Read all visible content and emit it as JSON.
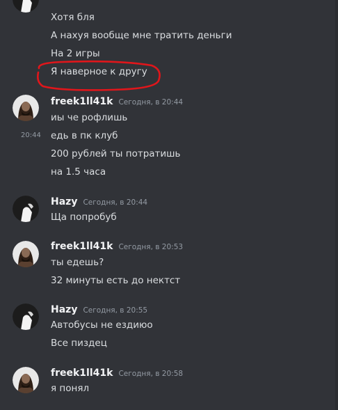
{
  "colors": {
    "background": "#313338",
    "author": "#f2f3f5",
    "text": "#dbdee1",
    "timestamp": "#949ba4",
    "annotation": "#e0161b"
  },
  "prev_group": {
    "lines": [
      "Хотя бля",
      "А нахуя вообще мне тратить деньги",
      "На 2 игры",
      "Я наверное к другу"
    ]
  },
  "groups": [
    {
      "author": "freek1ll41k",
      "timestamp": "Сегодня, в 20:44",
      "avatar_icon": "skull-portrait-avatar",
      "lines": [
        "иы че рофлишь",
        "едь в пк клуб",
        "200 рублей ты потратишь",
        "на 1.5 часа"
      ],
      "hover_time": "20:44"
    },
    {
      "author": "Hazy",
      "timestamp": "Сегодня, в 20:44",
      "avatar_icon": "white-figure-avatar",
      "lines": [
        "Ща попробуб"
      ]
    },
    {
      "author": "freek1ll41k",
      "timestamp": "Сегодня, в 20:53",
      "avatar_icon": "skull-portrait-avatar",
      "lines": [
        "ты едешь?",
        "32 минуты есть до нектст"
      ]
    },
    {
      "author": "Hazy",
      "timestamp": "Сегодня, в 20:55",
      "avatar_icon": "white-figure-avatar",
      "lines": [
        "Автобусы не ездиюо",
        "Все пиздец"
      ]
    },
    {
      "author": "freek1ll41k",
      "timestamp": "Сегодня, в 20:58",
      "avatar_icon": "skull-portrait-avatar",
      "lines": [
        "я понял"
      ]
    }
  ]
}
